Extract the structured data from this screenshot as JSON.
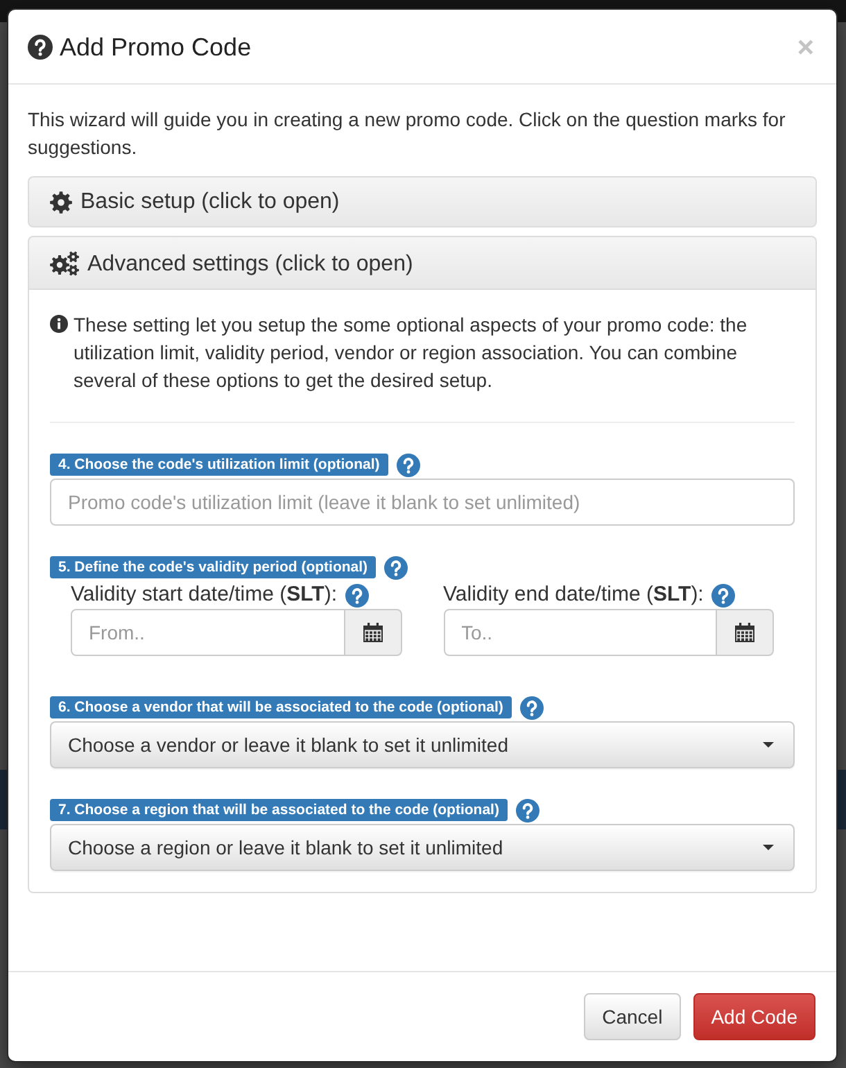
{
  "dialog": {
    "title": "Add Promo Code",
    "close": "×"
  },
  "intro": "This wizard will guide you in creating a new promo code. Click on the question marks for suggestions.",
  "panels": [
    {
      "kind": "basic",
      "heading": "Basic setup (click to open)",
      "expanded": false
    },
    {
      "kind": "advanced",
      "heading": "Advanced settings (click to open)",
      "expanded": true,
      "info": "These setting let you setup the some optional aspects of your promo code: the utilization limit, validity period, vendor or region association. You can combine several of these options to get the desired setup.",
      "fields": [
        {
          "kind": "text",
          "label": "4. Choose the code's utilization limit (optional)",
          "placeholder": "Promo code's utilization limit (leave it blank to set unlimited)"
        },
        {
          "kind": "daterange",
          "label": "5. Define the code's validity period (optional)",
          "parts": [
            {
              "label": "Validity start date/time (**SLT**):",
              "placeholder": "From.."
            },
            {
              "label": "Validity end date/time (**SLT**):",
              "placeholder": "To.."
            }
          ]
        },
        {
          "kind": "select",
          "label": "6. Choose a vendor that will be associated to the code (optional)",
          "value": "Choose a vendor or leave it blank to set it unlimited"
        },
        {
          "kind": "select",
          "label": "7. Choose a region that will be associated to the code (optional)",
          "value": "Choose a region or leave it blank to set it unlimited"
        }
      ]
    }
  ],
  "buttons": [
    {
      "kind": "default",
      "label": "Cancel"
    },
    {
      "kind": "danger",
      "label": "Add Code"
    }
  ]
}
